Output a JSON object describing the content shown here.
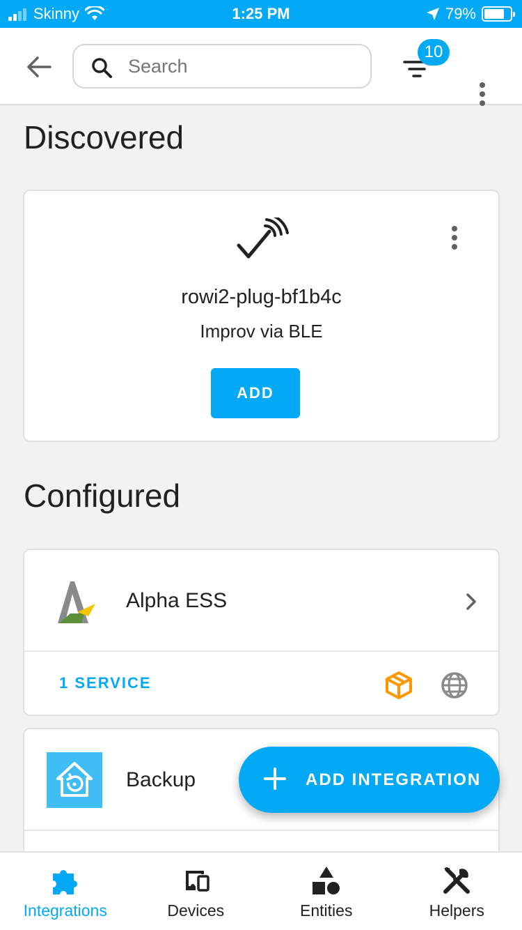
{
  "status_bar": {
    "carrier": "Skinny",
    "time": "1:25 PM",
    "battery": "79%",
    "battery_level": 0.79
  },
  "toolbar": {
    "search_placeholder": "Search",
    "filter_count": "10",
    "icons": [
      "arrow-left-icon",
      "search-icon",
      "filter-icon",
      "more-vertical-icon"
    ]
  },
  "discovered": {
    "heading": "Discovered",
    "card": {
      "name": "rowi2-plug-bf1b4c",
      "source": "Improv via BLE",
      "add_label": "ADD",
      "icon": "wireless-check-icon"
    }
  },
  "configured": {
    "heading": "Configured",
    "integrations": [
      {
        "name": "Alpha ESS",
        "services": "1 SERVICE",
        "icons": [
          "custom-package-icon",
          "cloud-globe-icon"
        ]
      },
      {
        "name": "Backup"
      }
    ]
  },
  "fab": {
    "label": "ADD INTEGRATION"
  },
  "bottom_nav": {
    "items": [
      {
        "label": "Integrations",
        "active": true,
        "icon": "puzzle-icon"
      },
      {
        "label": "Devices",
        "active": false,
        "icon": "devices-icon"
      },
      {
        "label": "Entities",
        "active": false,
        "icon": "shapes-icon"
      },
      {
        "label": "Helpers",
        "active": false,
        "icon": "tools-icon"
      }
    ]
  },
  "colors": {
    "accent": "#03a9f4",
    "background": "#f2f2f2",
    "text": "#212121",
    "package_orange": "#ff9800"
  }
}
